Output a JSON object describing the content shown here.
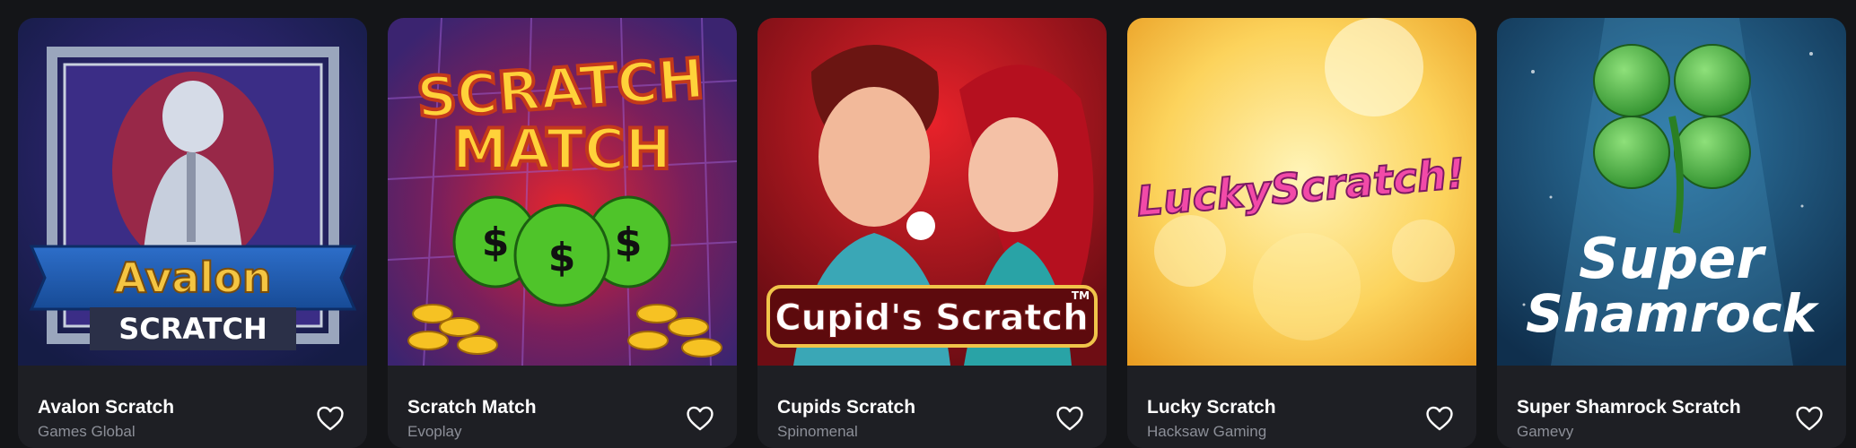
{
  "games": [
    {
      "title": "Avalon Scratch",
      "provider": "Games Global",
      "art_title": "Avalon",
      "art_subtitle": "SCRATCH"
    },
    {
      "title": "Scratch Match",
      "provider": "Evoplay",
      "art_title": "SCRATCH",
      "art_subtitle": "MATCH"
    },
    {
      "title": "Cupids Scratch",
      "provider": "Spinomenal",
      "art_title": "Cupid's Scratch",
      "art_badge": "TM"
    },
    {
      "title": "Lucky Scratch",
      "provider": "Hacksaw Gaming",
      "art_title": "LuckyScratch!"
    },
    {
      "title": "Super Shamrock Scratch",
      "provider": "Gamevy",
      "art_title": "Super",
      "art_subtitle": "Shamrock"
    }
  ],
  "icons": {
    "favorite": "heart-outline-icon"
  },
  "colors": {
    "page_bg": "#141518",
    "card_bg": "#1e1f24",
    "provider_text": "#8c8f98"
  }
}
